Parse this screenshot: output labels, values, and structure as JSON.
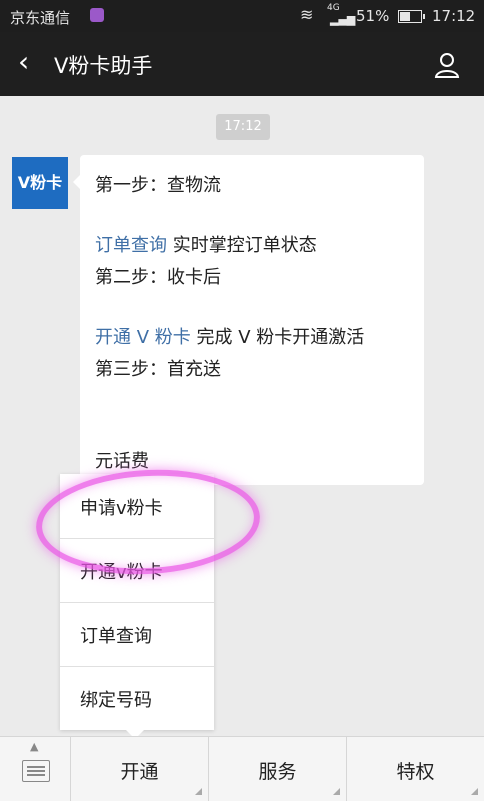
{
  "status": {
    "carrier": "京东通信",
    "network": "4G",
    "battery": "51%",
    "time": "17:12"
  },
  "header": {
    "back_icon": "‹",
    "title": "V粉卡助手"
  },
  "chat": {
    "timestamp": "17:12",
    "avatar_text": "V粉卡",
    "lines": {
      "step1": "第一步：查物流",
      "order_link": "订单查询",
      "order_desc": "实时掌控订单状态",
      "step2": "第二步：收卡后",
      "activate_link": "开通 V 粉卡",
      "activate_desc": "完成 V 粉卡开通激活",
      "step3": "第三步：首充送",
      "partial": "元话费"
    }
  },
  "menu": {
    "items": [
      "申请v粉卡",
      "开通v粉卡",
      "订单查询",
      "绑定号码"
    ]
  },
  "bottom": {
    "keyboard_arrow": "▲",
    "tabs": [
      "开通",
      "服务",
      "特权"
    ]
  },
  "colors": {
    "link": "#3f6fa6",
    "highlight": "#e954e6",
    "avatar": "#1e6cc1"
  }
}
